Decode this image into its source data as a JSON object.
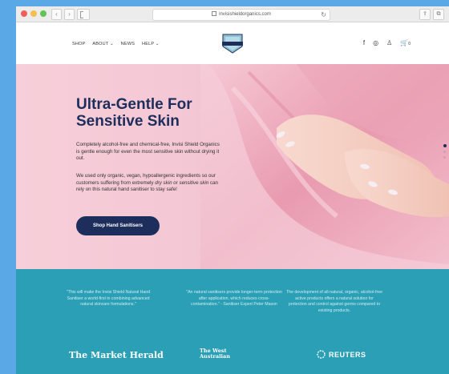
{
  "browser": {
    "url": "invisishieldorganics.com",
    "reload_icon": "reload-icon",
    "back_glyph": "‹",
    "forward_glyph": "›"
  },
  "nav": {
    "items": [
      "SHOP",
      "ABOUT ⌄",
      "NEWS",
      "HELP ⌄"
    ],
    "cart_count": "0"
  },
  "hero": {
    "title_line1": "Ultra-Gentle For",
    "title_line2": "Sensitive Skin",
    "paragraph1": "Completely alcohol-free and chemical-free, Invisi Shield Organics is gentle enough for even the most sensitive skin without drying it out.",
    "paragraph2_a": "We used only organic, vegan, hypoallergenic ingredients so our customers suffering from extremely ",
    "paragraph2_em": "dry skin or sensitive skin",
    "paragraph2_b": " can rely on this natural hand sanitiser to stay safe!",
    "cta_label": "Shop Hand Sanitisers"
  },
  "press": {
    "quotes": [
      "\"This will make the Invisi Shield Natural Hand Sanitiser a world-first in combining advanced natural skincare formulations.\"",
      "\"An natural sanitisers provide longer-term protection after application, which reduces cross-contamination.\" - Sanitiser Expert Peter Mason",
      "The development of all-natural, organic, alcohol-free active products offers a natural solution for protection and control against germs compared to existing products."
    ],
    "brands": [
      "The Market Herald",
      "The West Australian",
      "REUTERS"
    ]
  },
  "colors": {
    "accent": "#1d2e5c",
    "teal": "#2a9fb5",
    "hero_pink": "#f4c6d3"
  }
}
